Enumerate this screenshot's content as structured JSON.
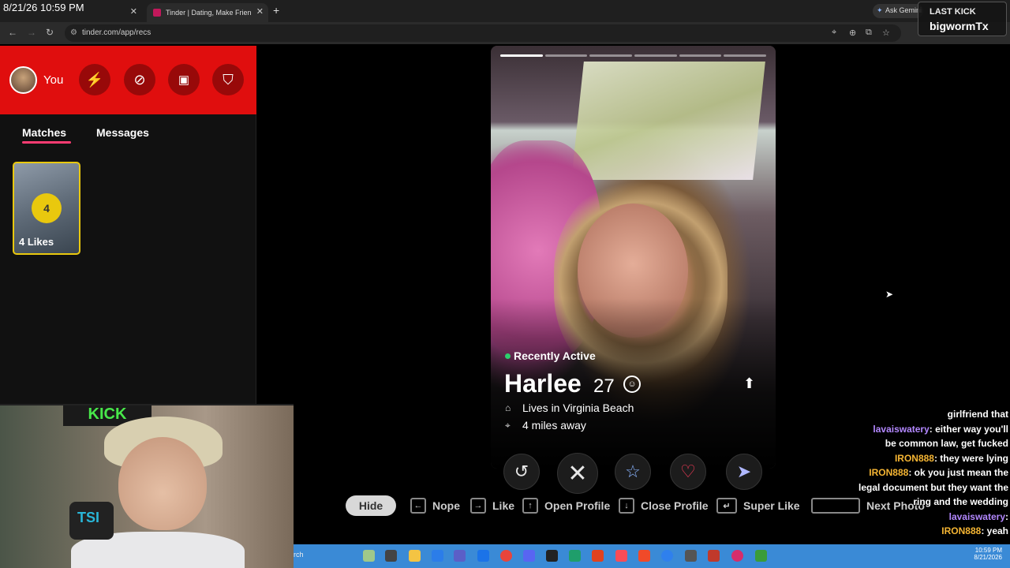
{
  "overlay": {
    "datetime": "8/21/26 10:59 PM"
  },
  "browser": {
    "tabs": [
      {
        "title": "",
        "active": false
      },
      {
        "title": "Tinder | Dating, Make Friends &",
        "active": true
      }
    ],
    "new_tab": "+",
    "url": "tinder.com/app/recs",
    "gemini": "Ask Gemini",
    "close_glyph": "✕"
  },
  "kick_overlay": {
    "line1": "LAST KICK",
    "line2": "bigwormTx"
  },
  "sidebar": {
    "you_label": "You",
    "header_buttons": [
      "boost-icon",
      "explore-icon",
      "briefcase-icon",
      "shield-icon"
    ],
    "tab_matches": "Matches",
    "tab_messages": "Messages",
    "likes": {
      "count": "4",
      "label": "4 Likes"
    }
  },
  "webcam": {
    "banner": "KICK",
    "mic_logo": "TSI"
  },
  "profile": {
    "photo_count": 6,
    "current_photo": 1,
    "status": "Recently Active",
    "name": "Harlee",
    "age": "27",
    "lives_in": "Lives in Virginia Beach",
    "distance": "4 miles away"
  },
  "actions": [
    {
      "name": "rewind-button",
      "glyph": "↺",
      "color": "#e8e8e8"
    },
    {
      "name": "nope-button",
      "glyph": "✕",
      "color": "#e8e8e8"
    },
    {
      "name": "super-like-button",
      "glyph": "☆",
      "color": "#8ab4ff"
    },
    {
      "name": "like-button",
      "glyph": "♡",
      "color": "#fe3c5a"
    },
    {
      "name": "boost-send-button",
      "glyph": "➤",
      "color": "#b0b8ff"
    }
  ],
  "hints": {
    "hide": "Hide",
    "nope": "Nope",
    "like": "Like",
    "open_profile": "Open Profile",
    "close_profile": "Close Profile",
    "super_like": "Super Like",
    "next_photo": "Next Photo"
  },
  "chat": [
    {
      "user": "",
      "text": "girlfriend that"
    },
    {
      "user": "lavaiswatery",
      "text": ": either way you'll"
    },
    {
      "user": "",
      "text": "be common law, get fucked"
    },
    {
      "user": "IRON888",
      "text": ": they were lying"
    },
    {
      "user": "IRON888",
      "text": ": ok you just mean the"
    },
    {
      "user": "",
      "text": "legal document but they want the"
    },
    {
      "user": "",
      "text": "ring and the wedding"
    },
    {
      "user": "lavaiswatery",
      "text": ":"
    },
    {
      "user": "IRON888",
      "text": ": yeah"
    }
  ],
  "taskbar": {
    "search": "rch",
    "time": "10:59 PM",
    "date": "8/21/2026"
  }
}
